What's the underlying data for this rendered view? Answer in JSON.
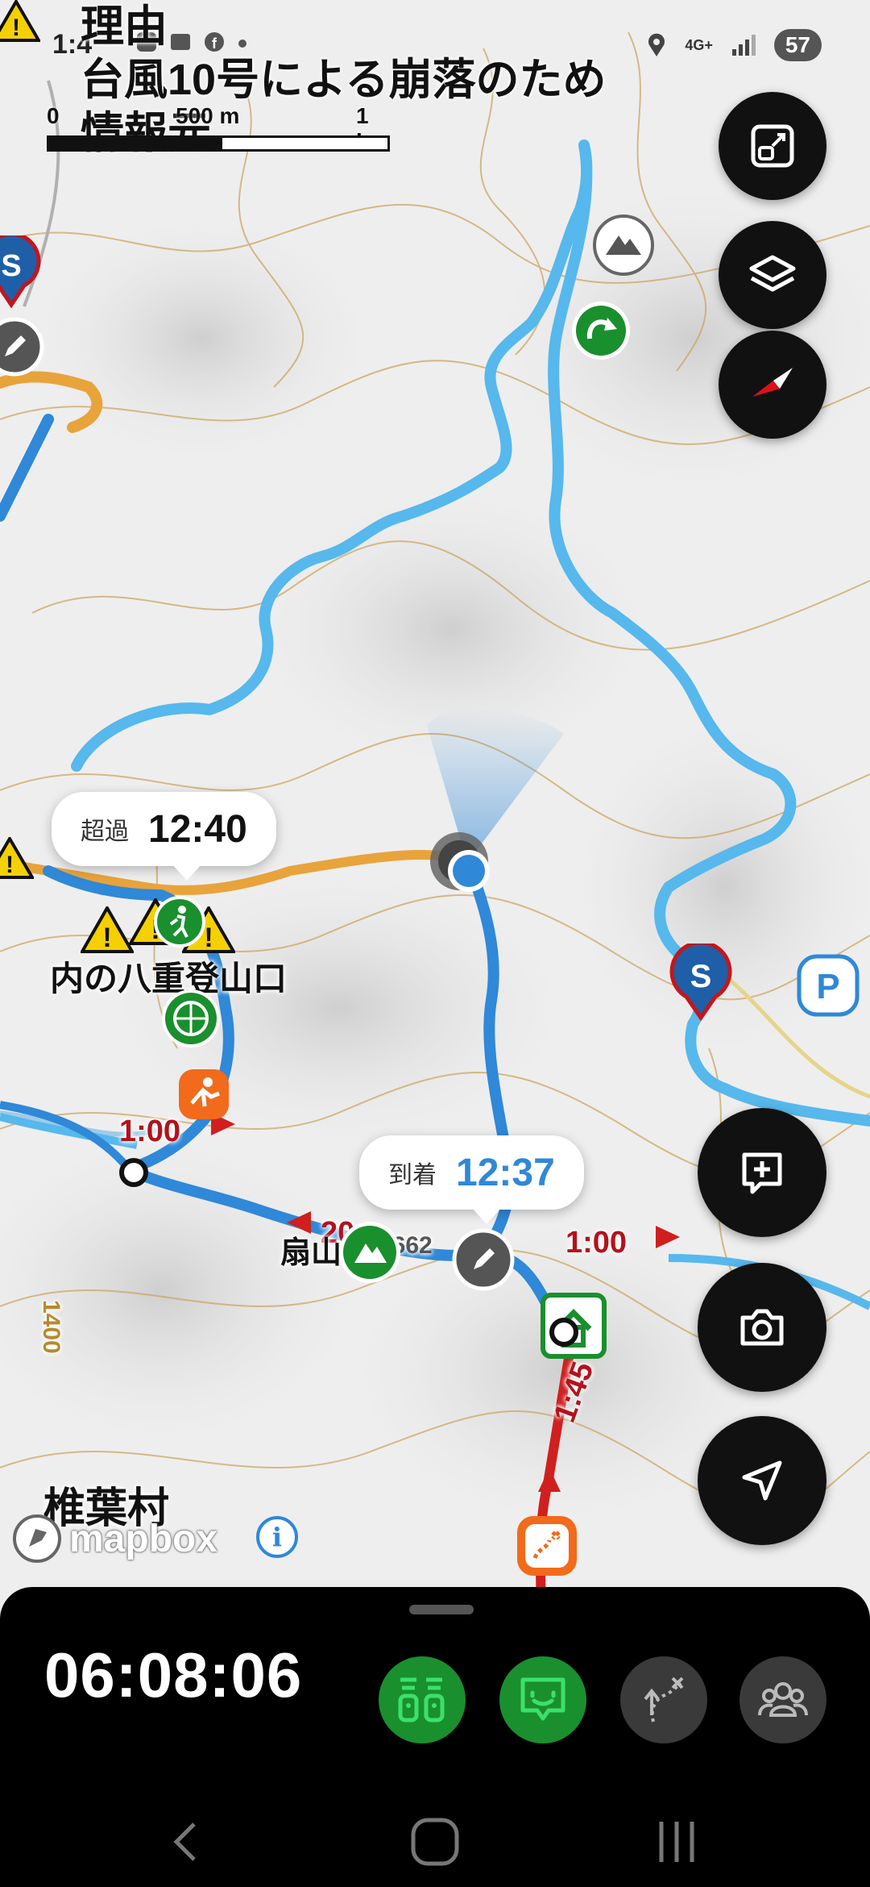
{
  "status_bar": {
    "time": "1:4",
    "network": "4G+",
    "battery": "57"
  },
  "notice": {
    "line1": "理由",
    "line2": "台風10号による崩落のため",
    "line3": "情報元..."
  },
  "scale_bar": {
    "zero": "0",
    "mid": "500 m",
    "end": "1 km"
  },
  "callouts": {
    "excess": {
      "label": "超過",
      "time": "12:40"
    },
    "arrival": {
      "label": "到着",
      "time": "12:37"
    }
  },
  "map_labels": {
    "trailhead": "内の八重登山口",
    "peak": "扇山",
    "peak_elev": "1662",
    "village": "椎葉村",
    "contour": "1400",
    "segment_1": "1:00",
    "segment_2": "20",
    "segment_3": "1:00",
    "segment_4": "1:45"
  },
  "attribution": {
    "brand": "mapbox",
    "info": "i"
  },
  "right_controls": [
    "fit-route",
    "layers",
    "compass",
    "add-memo",
    "camera",
    "locate"
  ],
  "bottom_panel": {
    "elapsed_time": "06:08:06",
    "tools": [
      {
        "name": "members-track",
        "color": "#1a8f2e"
      },
      {
        "name": "chat-map",
        "color": "#1a8f2e"
      },
      {
        "name": "route-deviation",
        "color": "#3a3a3a"
      },
      {
        "name": "group",
        "color": "#3a3a3a"
      }
    ]
  },
  "colors": {
    "route_light_blue": "#56b8ec",
    "route_blue": "#2f88d8",
    "route_orange": "#e8a33b",
    "route_red": "#d01f1f",
    "accent_green": "#1a8f2e"
  }
}
